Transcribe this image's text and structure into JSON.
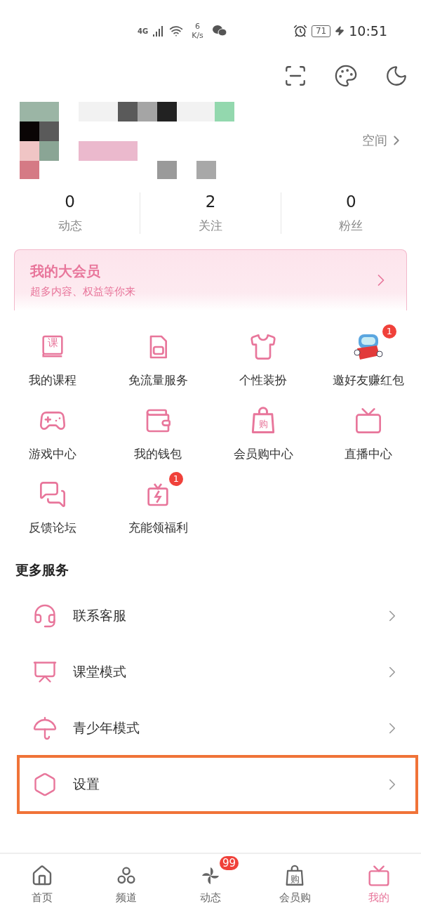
{
  "status_bar": {
    "network": "4G",
    "speed_value": "6",
    "speed_unit": "K/s",
    "battery": "71",
    "time": "10:51"
  },
  "profile": {
    "space_link": "空间"
  },
  "stats": [
    {
      "value": "0",
      "label": "动态"
    },
    {
      "value": "2",
      "label": "关注"
    },
    {
      "value": "0",
      "label": "粉丝"
    }
  ],
  "vip_card": {
    "title": "我的大会员",
    "subtitle": "超多内容、权益等你来"
  },
  "services": [
    {
      "label": "我的课程",
      "icon_text": "课"
    },
    {
      "label": "免流量服务"
    },
    {
      "label": "个性装扮"
    },
    {
      "label": "邀好友赚红包",
      "badge": "1"
    },
    {
      "label": "游戏中心"
    },
    {
      "label": "我的钱包"
    },
    {
      "label": "会员购中心",
      "icon_text": "购"
    },
    {
      "label": "直播中心"
    },
    {
      "label": "反馈论坛"
    },
    {
      "label": "充能领福利",
      "badge": "1"
    }
  ],
  "more_services": {
    "title": "更多服务",
    "items": [
      {
        "label": "联系客服",
        "highlighted": false
      },
      {
        "label": "课堂模式",
        "highlighted": false
      },
      {
        "label": "青少年模式",
        "highlighted": false
      },
      {
        "label": "设置",
        "highlighted": true
      }
    ]
  },
  "bottom_nav": [
    {
      "label": "首页",
      "selected": false
    },
    {
      "label": "频道",
      "selected": false
    },
    {
      "label": "动态",
      "selected": false,
      "badge": "99"
    },
    {
      "label": "会员购",
      "selected": false,
      "icon_text": "购"
    },
    {
      "label": "我的",
      "selected": true
    }
  ]
}
